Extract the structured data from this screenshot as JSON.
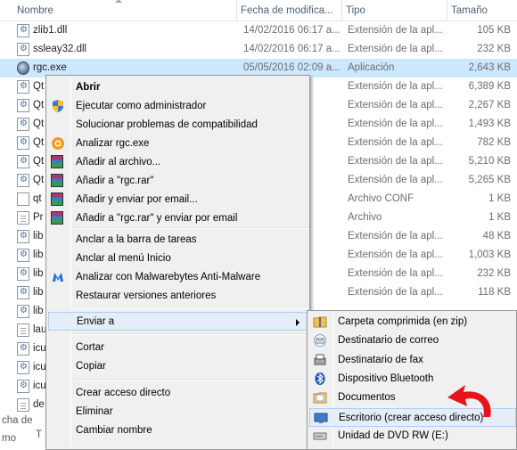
{
  "columns": {
    "name": "Nombre",
    "date": "Fecha de modifica...",
    "type": "Tipo",
    "size": "Tamaño"
  },
  "files": [
    {
      "name": "zlib1.dll",
      "date": "14/02/2016 06:17 a...",
      "type": "Extensión de la apl...",
      "size": "105 KB",
      "icon": "dll-file-icon"
    },
    {
      "name": "ssleay32.dll",
      "date": "14/02/2016 06:17 a...",
      "type": "Extensión de la apl...",
      "size": "232 KB",
      "icon": "dll-file-icon"
    },
    {
      "name": "rgc.exe",
      "date": "05/05/2016 02:09 a...",
      "type": "Aplicación",
      "size": "2,643 KB",
      "icon": "exe-app-icon",
      "selected": true
    },
    {
      "name": "Qt",
      "date": "",
      "type": "Extensión de la apl...",
      "size": "6,389 KB",
      "icon": "dll-file-icon"
    },
    {
      "name": "Qt",
      "date": "",
      "type": "Extensión de la apl...",
      "size": "2,267 KB",
      "icon": "dll-file-icon"
    },
    {
      "name": "Qt",
      "date": "",
      "type": "Extensión de la apl...",
      "size": "1,493 KB",
      "icon": "dll-file-icon"
    },
    {
      "name": "Qt",
      "date": "",
      "type": "Extensión de la apl...",
      "size": "782 KB",
      "icon": "dll-file-icon"
    },
    {
      "name": "Qt",
      "date": "",
      "type": "Extensión de la apl...",
      "size": "5,210 KB",
      "icon": "dll-file-icon"
    },
    {
      "name": "Qt",
      "date": "",
      "type": "Extensión de la apl...",
      "size": "5,265 KB",
      "icon": "dll-file-icon"
    },
    {
      "name": "qt",
      "date": "",
      "type": "Archivo CONF",
      "size": "1 KB",
      "icon": "conf-file-icon"
    },
    {
      "name": "Pr",
      "date": "",
      "type": "Archivo",
      "size": "1 KB",
      "icon": "generic-file-icon"
    },
    {
      "name": "lib",
      "date": "",
      "type": "Extensión de la apl...",
      "size": "48 KB",
      "icon": "dll-file-icon"
    },
    {
      "name": "lib",
      "date": "",
      "type": "Extensión de la apl...",
      "size": "1,003 KB",
      "icon": "dll-file-icon"
    },
    {
      "name": "lib",
      "date": "",
      "type": "Extensión de la apl...",
      "size": "232 KB",
      "icon": "dll-file-icon"
    },
    {
      "name": "lib",
      "date": "",
      "type": "Extensión de la apl...",
      "size": "118 KB",
      "icon": "dll-file-icon"
    },
    {
      "name": "lib",
      "date": "",
      "type": "",
      "size": "",
      "icon": "dll-file-icon"
    },
    {
      "name": "lau",
      "date": "",
      "type": "",
      "size": "",
      "icon": "generic-file-icon"
    },
    {
      "name": "icu",
      "date": "",
      "type": "",
      "size": "",
      "icon": "dll-file-icon"
    },
    {
      "name": "icu",
      "date": "",
      "type": "",
      "size": "",
      "icon": "dll-file-icon"
    },
    {
      "name": "icu",
      "date": "",
      "type": "",
      "size": "",
      "icon": "dll-file-icon"
    },
    {
      "name": "de",
      "date": "",
      "type": "",
      "size": "",
      "icon": "generic-file-icon"
    }
  ],
  "status": {
    "left": "cha de mo",
    "left2": "T"
  },
  "context_menu": {
    "items": [
      {
        "label": "Abrir",
        "bold": true,
        "icon": ""
      },
      {
        "label": "Ejecutar como administrador",
        "icon": "uac-shield-icon"
      },
      {
        "label": "Solucionar problemas de compatibilidad",
        "icon": ""
      },
      {
        "label": "Analizar rgc.exe",
        "icon": "avast-icon"
      },
      {
        "label": "Añadir al archivo...",
        "icon": "winrar-icon"
      },
      {
        "label": "Añadir a \"rgc.rar\"",
        "icon": "winrar-icon"
      },
      {
        "label": "Añadir y enviar por email...",
        "icon": "winrar-icon"
      },
      {
        "label": "Añadir a \"rgc.rar\" y enviar por email",
        "icon": "winrar-icon"
      },
      {
        "label": "Anclar a la barra de tareas",
        "icon": ""
      },
      {
        "label": "Anclar al menú Inicio",
        "icon": ""
      },
      {
        "label": "Analizar con Malwarebytes Anti-Malware",
        "icon": "malwarebytes-icon"
      },
      {
        "label": "Restaurar versiones anteriores",
        "icon": ""
      },
      {
        "label": "Enviar a",
        "icon": "",
        "submenu": true
      },
      {
        "label": "Cortar",
        "icon": ""
      },
      {
        "label": "Copiar",
        "icon": ""
      },
      {
        "label": "Crear acceso directo",
        "icon": ""
      },
      {
        "label": "Eliminar",
        "icon": ""
      },
      {
        "label": "Cambiar nombre",
        "icon": ""
      }
    ]
  },
  "send_to_menu": {
    "items": [
      {
        "label": "Carpeta comprimida (en zip)",
        "icon": "zip-folder-icon"
      },
      {
        "label": "Destinatario de correo",
        "icon": "mail-recipient-icon"
      },
      {
        "label": "Destinatario de fax",
        "icon": "fax-icon"
      },
      {
        "label": "Dispositivo Bluetooth",
        "icon": "bluetooth-icon"
      },
      {
        "label": "Documentos",
        "icon": "documents-icon"
      },
      {
        "label": "Escritorio (crear acceso directo)",
        "icon": "desktop-icon",
        "hover": true
      },
      {
        "label": "Unidad de DVD RW (E:)",
        "icon": "dvd-drive-icon"
      }
    ]
  },
  "annotation": {
    "arrow_color": "#e8141b"
  }
}
